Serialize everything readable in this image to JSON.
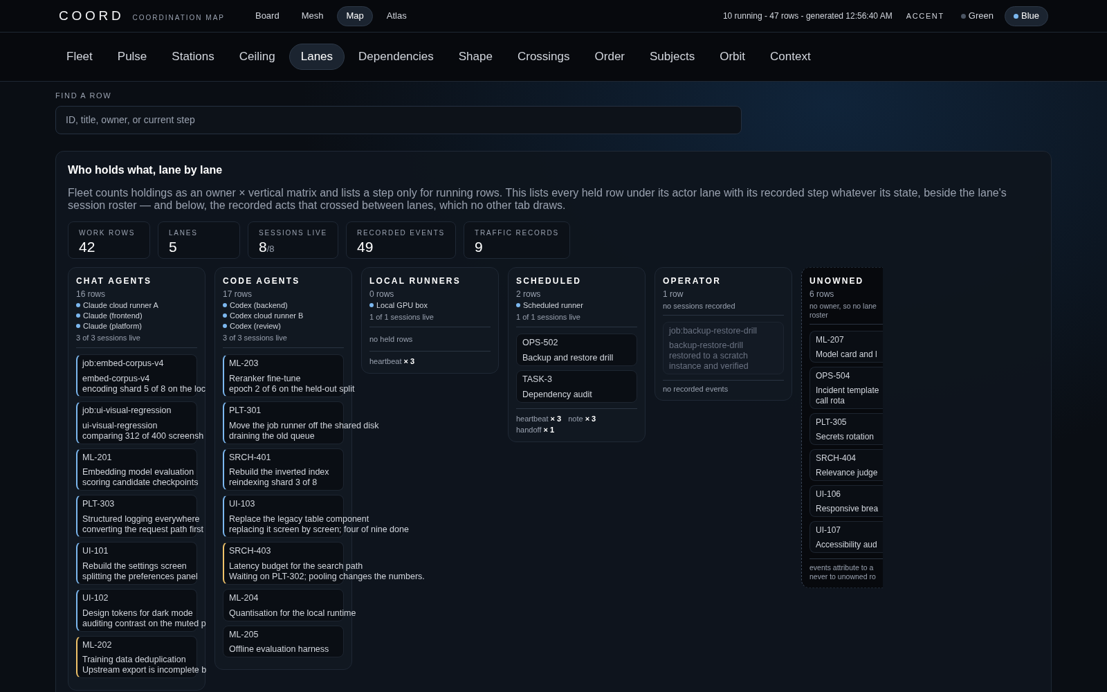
{
  "brand": {
    "logo": "COORD",
    "subtitle": "COORDINATION MAP"
  },
  "nav": [
    {
      "label": "Board",
      "selected": false
    },
    {
      "label": "Mesh",
      "selected": false
    },
    {
      "label": "Map",
      "selected": true
    },
    {
      "label": "Atlas",
      "selected": false
    }
  ],
  "status": "10 running - 47 rows - generated 12:56:40 AM",
  "accent": {
    "label": "ACCENT",
    "options": [
      {
        "label": "Green",
        "selected": false,
        "color": "#4b5563"
      },
      {
        "label": "Blue",
        "selected": true,
        "color": "#7cb8f0"
      }
    ]
  },
  "tabs": [
    {
      "label": "Fleet",
      "selected": false
    },
    {
      "label": "Pulse",
      "selected": false
    },
    {
      "label": "Stations",
      "selected": false
    },
    {
      "label": "Ceiling",
      "selected": false
    },
    {
      "label": "Lanes",
      "selected": true
    },
    {
      "label": "Dependencies",
      "selected": false
    },
    {
      "label": "Shape",
      "selected": false
    },
    {
      "label": "Crossings",
      "selected": false
    },
    {
      "label": "Order",
      "selected": false
    },
    {
      "label": "Subjects",
      "selected": false
    },
    {
      "label": "Orbit",
      "selected": false
    },
    {
      "label": "Context",
      "selected": false
    }
  ],
  "search": {
    "label": "FIND A ROW",
    "placeholder": "ID, title, owner, or current step"
  },
  "panel": {
    "title": "Who holds what, lane by lane",
    "description": "Fleet counts holdings as an owner × vertical matrix and lists a step only for running rows. This lists every held row under its actor lane with its recorded step whatever its state, beside the lane's session roster — and below, the recorded acts that crossed between lanes, which no other tab draws.",
    "stats": [
      {
        "label": "WORK ROWS",
        "value": "42"
      },
      {
        "label": "LANES",
        "value": "5"
      },
      {
        "label": "SESSIONS LIVE",
        "value": "8",
        "total": "/8"
      },
      {
        "label": "RECORDED EVENTS",
        "value": "49"
      },
      {
        "label": "TRAFFIC RECORDS",
        "value": "9"
      }
    ],
    "lanes": [
      {
        "kind": "owned",
        "name": "CHAT AGENTS",
        "count": "16 rows",
        "sessions": [
          {
            "name": "Claude cloud runner A",
            "color": "#7cb8f0"
          },
          {
            "name": "Claude (frontend)",
            "color": "#7cb8f0"
          },
          {
            "name": "Claude (platform)",
            "color": "#7cb8f0"
          }
        ],
        "sessions_live": "3 of 3 sessions live",
        "rows": [
          {
            "kind": "running",
            "id": "job:embed-corpus-v4",
            "title": "embed-corpus-v4",
            "step": "encoding shard 5 of 8 on the loc"
          },
          {
            "kind": "running",
            "id": "job:ui-visual-regression",
            "title": "ui-visual-regression",
            "step": "comparing 312 of 400 screensh"
          },
          {
            "kind": "running",
            "id": "ML-201",
            "title": "Embedding model evaluation",
            "step": "scoring candidate checkpoints"
          },
          {
            "kind": "running",
            "id": "PLT-303",
            "title": "Structured logging everywhere",
            "step": "converting the request path first"
          },
          {
            "kind": "running",
            "id": "UI-101",
            "title": "Rebuild the settings screen",
            "step": "splitting the preferences panel"
          },
          {
            "kind": "running",
            "id": "UI-102",
            "title": "Design tokens for dark mode",
            "step": "auditing contrast on the muted p"
          },
          {
            "kind": "waiting",
            "id": "ML-202",
            "title": "Training data deduplication",
            "step": "Upstream export is incomplete b"
          }
        ]
      },
      {
        "kind": "owned",
        "name": "CODE AGENTS",
        "count": "17 rows",
        "sessions": [
          {
            "name": "Codex (backend)",
            "color": "#7cb8f0"
          },
          {
            "name": "Codex cloud runner B",
            "color": "#7cb8f0"
          },
          {
            "name": "Codex (review)",
            "color": "#7cb8f0"
          }
        ],
        "sessions_live": "3 of 3 sessions live",
        "rows": [
          {
            "kind": "running",
            "id": "ML-203",
            "title": "Reranker fine-tune",
            "step": "epoch 2 of 6 on the held-out split"
          },
          {
            "kind": "running",
            "id": "PLT-301",
            "title": "Move the job runner off the shared disk",
            "step": "draining the old queue"
          },
          {
            "kind": "running",
            "id": "SRCH-401",
            "title": "Rebuild the inverted index",
            "step": "reindexing shard 3 of 8"
          },
          {
            "kind": "running",
            "id": "UI-103",
            "title": "Replace the legacy table component",
            "step": "replacing it screen by screen; four of nine done"
          },
          {
            "kind": "waiting",
            "id": "SRCH-403",
            "title": "Latency budget for the search path",
            "step": "Waiting on PLT-302; pooling changes the numbers."
          },
          {
            "kind": "idle",
            "id": "ML-204",
            "title": "Quantisation for the local runtime"
          },
          {
            "kind": "idle",
            "id": "ML-205",
            "title": "Offline evaluation harness"
          }
        ]
      },
      {
        "kind": "owned",
        "name": "LOCAL RUNNERS",
        "count": "0 rows",
        "sessions": [
          {
            "name": "Local GPU box",
            "color": "#7cb8f0"
          }
        ],
        "sessions_live": "1 of 1 sessions live",
        "empty": "no held rows",
        "events": [
          {
            "name": "heartbeat",
            "count": "× 3"
          }
        ]
      },
      {
        "kind": "owned",
        "name": "SCHEDULED",
        "count": "2 rows",
        "sessions": [
          {
            "name": "Scheduled runner",
            "color": "#7cb8f0"
          }
        ],
        "sessions_live": "1 of 1 sessions live",
        "rows": [
          {
            "kind": "idle",
            "id": "OPS-502",
            "title": "Backup and restore drill"
          },
          {
            "kind": "idle",
            "id": "TASK-3",
            "title": "Dependency audit"
          }
        ],
        "events": [
          {
            "name": "heartbeat",
            "count": "× 3"
          },
          {
            "name": "note",
            "count": "× 3"
          },
          {
            "name": "handoff",
            "count": "× 1"
          }
        ]
      },
      {
        "kind": "owned",
        "name": "OPERATOR",
        "count": "1 row",
        "no_sessions": "no sessions recorded",
        "rows": [
          {
            "kind": "done",
            "id": "job:backup-restore-drill",
            "title": "backup-restore-drill",
            "step": "restored to a scratch instance and verified"
          }
        ],
        "events_note": "no recorded events"
      },
      {
        "kind": "unowned",
        "name": "UNOWNED",
        "count": "6 rows",
        "no_sessions": "no owner, so no lane roster",
        "rows": [
          {
            "kind": "idle",
            "id": "ML-207",
            "title": "Model card and l"
          },
          {
            "kind": "idle",
            "id": "OPS-504",
            "title": "Incident template",
            "step": "call rota"
          },
          {
            "kind": "idle",
            "id": "PLT-305",
            "title": "Secrets rotation"
          },
          {
            "kind": "idle",
            "id": "SRCH-404",
            "title": "Relevance judge"
          },
          {
            "kind": "idle",
            "id": "UI-106",
            "title": "Responsive brea"
          },
          {
            "kind": "idle",
            "id": "UI-107",
            "title": "Accessibility aud"
          }
        ],
        "events_note": "events attribute to a never to unowned ro"
      }
    ]
  }
}
